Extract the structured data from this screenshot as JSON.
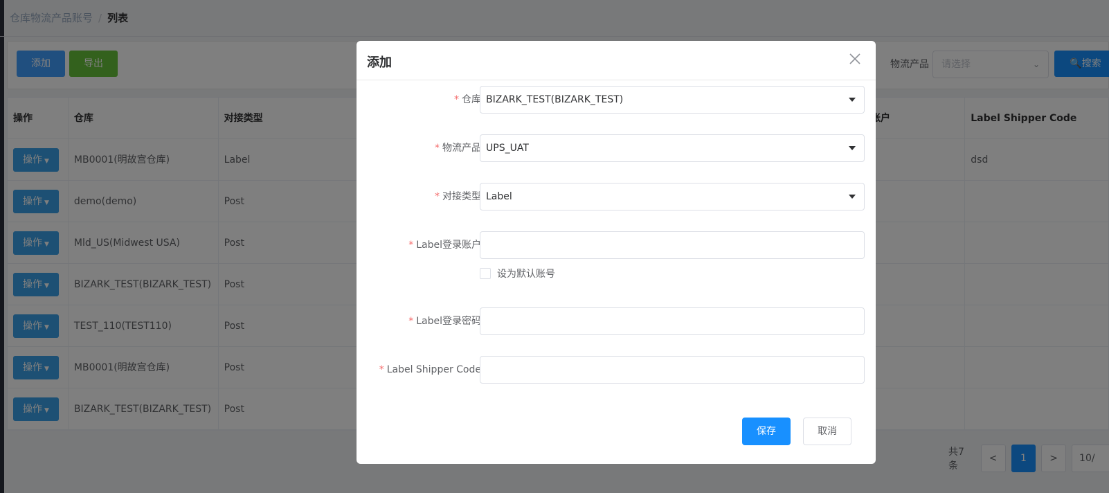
{
  "breadcrumb": {
    "parent": "仓库物流产品账号",
    "separator": "/",
    "current": "列表"
  },
  "toolbar": {
    "add_label": "添加",
    "export_label": "导出",
    "filter_label": "物流产品",
    "filter_placeholder": "请选择",
    "search_label": "搜索"
  },
  "table": {
    "headers": [
      "操作",
      "仓库",
      "对接类型",
      "账户",
      "Label Shipper Code"
    ],
    "op_label": "操作",
    "rows": [
      {
        "warehouse": "MB0001(明故宫仓库)",
        "type": "Label",
        "shipper_code": "dsd"
      },
      {
        "warehouse": "demo(demo)",
        "type": "Post",
        "shipper_code": ""
      },
      {
        "warehouse": "Mld_US(Midwest USA)",
        "type": "Post",
        "shipper_code": ""
      },
      {
        "warehouse": "BIZARK_TEST(BIZARK_TEST)",
        "type": "Post",
        "shipper_code": ""
      },
      {
        "warehouse": "TEST_110(TEST110)",
        "type": "Post",
        "shipper_code": ""
      },
      {
        "warehouse": "MB0001(明故宫仓库)",
        "type": "Post",
        "shipper_code": ""
      },
      {
        "warehouse": "BIZARK_TEST(BIZARK_TEST)",
        "type": "Post",
        "shipper_code": ""
      }
    ]
  },
  "pagination": {
    "total": "共7条",
    "prev": "<",
    "current_page": "1",
    "next": ">",
    "page_size": "10/"
  },
  "dialog": {
    "title": "添加",
    "required_mark": "*",
    "fields": {
      "warehouse": {
        "label": "仓库",
        "value": "BIZARK_TEST(BIZARK_TEST)"
      },
      "product": {
        "label": "物流产品",
        "value": "UPS_UAT"
      },
      "type": {
        "label": "对接类型",
        "value": "Label"
      },
      "account": {
        "label": "Label登录账户",
        "value": ""
      },
      "password": {
        "label": "Label登录密码",
        "value": ""
      },
      "shipper_code": {
        "label": "Label Shipper Code",
        "value": ""
      }
    },
    "default_checkbox_label": "设为默认账号",
    "save_label": "保存",
    "cancel_label": "取消"
  }
}
